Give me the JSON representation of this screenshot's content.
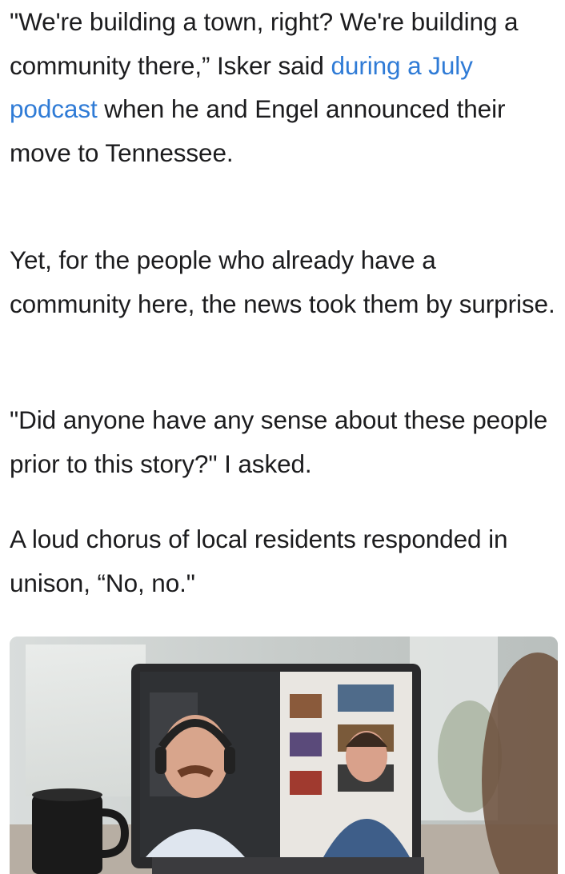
{
  "article": {
    "p1_text_a": "\"We're building a town, right? We're building a community there,” Isker said ",
    "p1_link": "during a July podcast",
    "p1_text_b": " when he and Engel announced their move to Tennessee.",
    "p2_text": "Yet, for the people who already have a community here, the news took them by surprise.",
    "p3_text": "\"Did anyone have any sense about these people prior to this story?\" I asked.",
    "p4_text": "A loud chorus of local residents responded in unison, “No, no.\""
  },
  "photo": {
    "subject": "laptop-video-call-two-men",
    "colors": {
      "link": "#2f7bd6",
      "mug": "#1a1a1a",
      "laptop": "#2a2a2c"
    }
  }
}
